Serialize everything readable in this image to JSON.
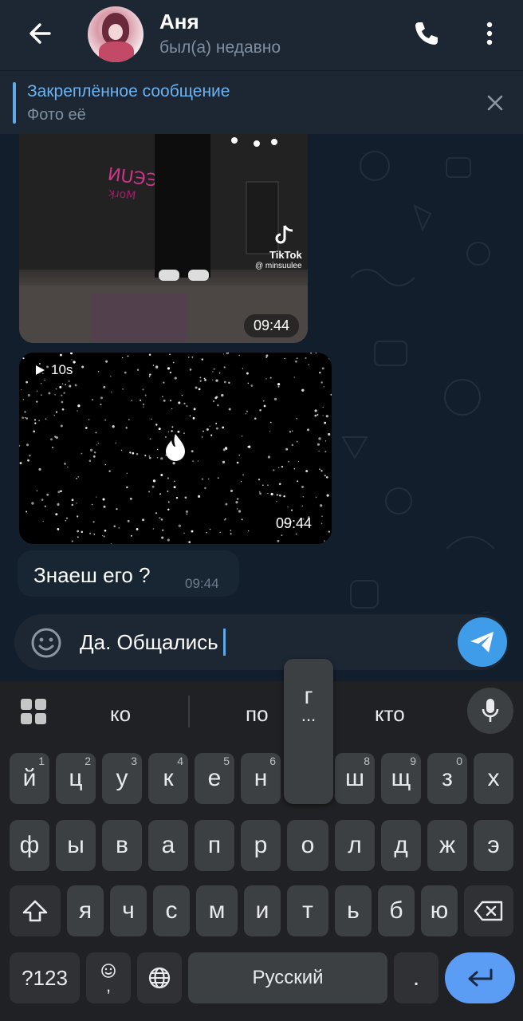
{
  "header": {
    "contact_name": "Аня",
    "status": "был(а) недавно"
  },
  "pinned": {
    "title": "Закреплённое сообщение",
    "text": "Фото её"
  },
  "messages": [
    {
      "type": "video",
      "time": "09:44",
      "watermark_brand": "TikTok",
      "watermark_user": "@ minsuulee"
    },
    {
      "type": "video",
      "duration": "10s",
      "time": "09:44"
    },
    {
      "type": "text",
      "text": "Знаеш его ?",
      "time": "09:44"
    }
  ],
  "composer": {
    "value": "Да. Общались"
  },
  "keyboard": {
    "suggestions": [
      "ко",
      "по",
      "кто"
    ],
    "popup": {
      "char": "г",
      "more": "..."
    },
    "row1": [
      {
        "k": "й",
        "n": "1"
      },
      {
        "k": "ц",
        "n": "2"
      },
      {
        "k": "у",
        "n": "3"
      },
      {
        "k": "к",
        "n": "4"
      },
      {
        "k": "е",
        "n": "5"
      },
      {
        "k": "н",
        "n": "6"
      },
      {
        "k": "ш",
        "n": "8"
      },
      {
        "k": "щ",
        "n": "9"
      },
      {
        "k": "з",
        "n": "0"
      },
      {
        "k": "х",
        "n": ""
      }
    ],
    "row2": [
      "ф",
      "ы",
      "в",
      "а",
      "п",
      "р",
      "о",
      "л",
      "д",
      "ж",
      "э"
    ],
    "row3": [
      "я",
      "ч",
      "с",
      "м",
      "и",
      "т",
      "ь",
      "б",
      "ю"
    ],
    "symbols_label": "?123",
    "emoji_comma": ",",
    "space_label": "Русский",
    "period": "."
  }
}
